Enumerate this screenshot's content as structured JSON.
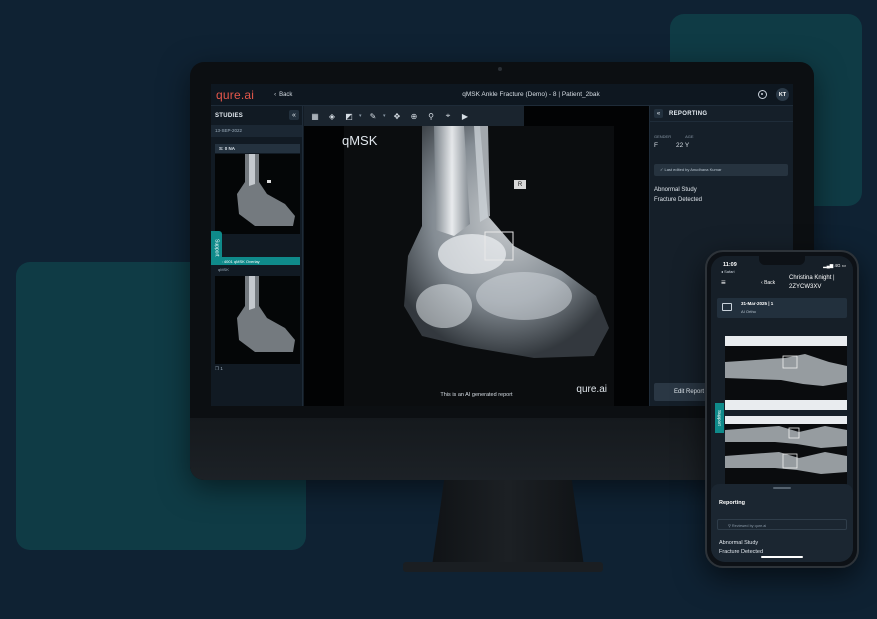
{
  "app": {
    "logo": "qure.ai",
    "back_label": "Back",
    "title": "qMSK Ankle Fracture (Demo) - 8 | Patient_2bak",
    "avatar_initials": "KT",
    "accent_color": "#0f8a8a",
    "logo_color": "#e4574b"
  },
  "studies": {
    "title": "STUDIES",
    "collapse_icon": "«",
    "date": "13-SEP-2022",
    "series_1_label": "S: 0   NA",
    "series_2_label": "S: 4001   qMSK Overlay",
    "series_2_sub": "qMSK",
    "image_count": "1",
    "support_label": "Support"
  },
  "toolbar": {
    "tools": [
      "grid-icon",
      "layers-icon",
      "contrast-icon",
      "pen-icon",
      "move-icon",
      "zoom-in-icon",
      "zoom-icon",
      "crosshair-icon",
      "play-icon"
    ]
  },
  "viewer": {
    "overlay_label": "qMSK",
    "ai_note": "This is an AI generated report",
    "brand": "qure.ai",
    "marker": "R"
  },
  "reporting": {
    "collapse_icon": "«",
    "title": "REPORTING",
    "gender_label": "GENDER",
    "age_label": "AGE",
    "gender": "F",
    "age": "22 Y",
    "edited_note": "Last edited by Anudhana Kumar",
    "finding_1": "Abnormal Study",
    "finding_2": "Fracture Detected",
    "edit_button": "Edit Report"
  },
  "phone": {
    "time": "11:09",
    "browser": "◂ Safari",
    "status": "▂▄▆ 4G ▭",
    "menu_icon": "≡",
    "back_label": "Back",
    "patient": "Christina Knight | 2ZYCW3XV",
    "study_date": "31-Mar-2025 | 1",
    "study_name": "AI Ortho",
    "support_label": "Support",
    "reporting_title": "Reporting",
    "search_placeholder": "Reviewed by qure.ai",
    "finding_1": "Abnormal Study",
    "finding_2": "Fracture Detected"
  }
}
